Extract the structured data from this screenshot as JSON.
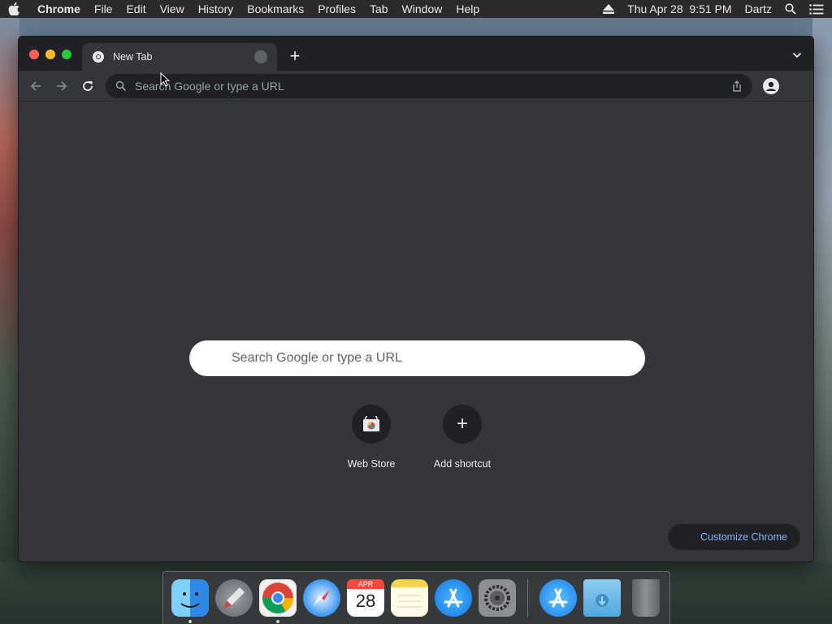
{
  "menubar": {
    "app_name": "Chrome",
    "items": [
      "File",
      "Edit",
      "View",
      "History",
      "Bookmarks",
      "Profiles",
      "Tab",
      "Window",
      "Help"
    ],
    "datetime": "Thu Apr 28  9:51 PM",
    "user": "Dartz"
  },
  "tab": {
    "title": "New Tab"
  },
  "omnibox": {
    "placeholder": "Search Google or type a URL"
  },
  "ntp": {
    "search_placeholder": "Search Google or type a URL",
    "shortcuts": [
      {
        "label": "Web Store",
        "icon": "web-store-icon"
      },
      {
        "label": "Add shortcut",
        "icon": "plus-icon"
      }
    ],
    "customize_label": "Customize Chrome"
  },
  "dock": {
    "apps": [
      "Finder",
      "Launchpad",
      "Google Chrome",
      "Safari",
      "Calendar",
      "Notes",
      "App Store",
      "System Preferences",
      "App Store Installer",
      "Downloads",
      "Trash"
    ],
    "calendar_month": "APR",
    "calendar_day": "28"
  },
  "colors": {
    "window_bg": "#35363a",
    "tabstrip_bg": "#202124",
    "accent_link": "#8ab4f8"
  }
}
